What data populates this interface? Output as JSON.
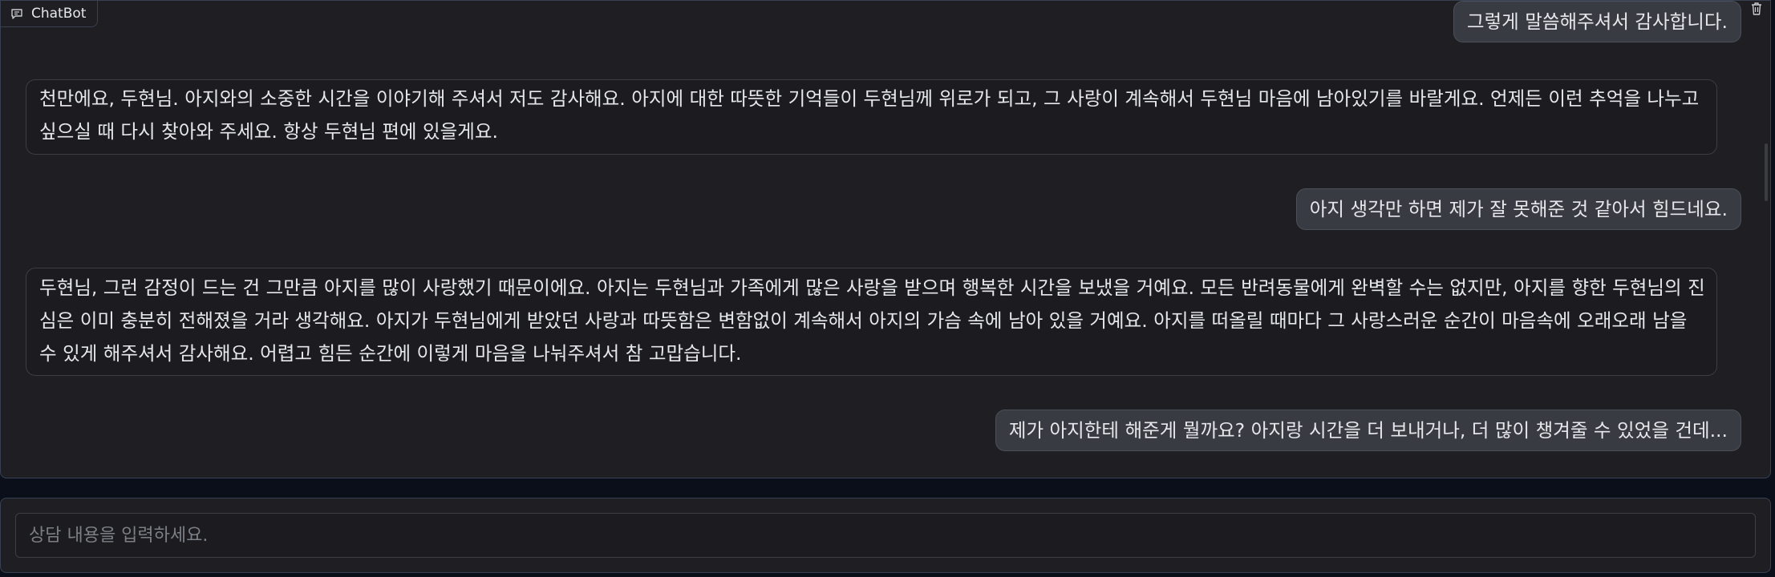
{
  "chatbot": {
    "label": "ChatBot",
    "icon": "chat-bubble-icon",
    "clear_icon": "trash-icon"
  },
  "messages": [
    {
      "role": "user",
      "text": "그렇게 말씀해주셔서 감사합니다."
    },
    {
      "role": "bot",
      "text": "천만에요, 두현님. 아지와의 소중한 시간을 이야기해 주셔서 저도 감사해요. 아지에 대한 따뜻한 기억들이 두현님께 위로가 되고, 그 사랑이 계속해서 두현님 마음에 남아있기를 바랄게요. 언제든 이런 추억을 나누고 싶으실 때 다시 찾아와 주세요. 항상 두현님 편에 있을게요."
    },
    {
      "role": "user",
      "text": "아지 생각만 하면 제가 잘 못해준 것 같아서 힘드네요."
    },
    {
      "role": "bot",
      "text": "두현님, 그런 감정이 드는 건 그만큼 아지를 많이 사랑했기 때문이에요. 아지는 두현님과 가족에게 많은 사랑을 받으며 행복한 시간을 보냈을 거예요. 모든 반려동물에게 완벽할 수는 없지만, 아지를 향한 두현님의 진심은 이미 충분히 전해졌을 거라 생각해요. 아지가 두현님에게 받았던 사랑과 따뜻함은 변함없이 계속해서 아지의 가슴 속에 남아 있을 거예요. 아지를 떠올릴 때마다 그 사랑스러운 순간이 마음속에 오래오래 남을 수 있게 해주셔서 감사해요. 어렵고 힘든 순간에 이렇게 마음을 나눠주셔서 참 고맙습니다."
    },
    {
      "role": "user",
      "text": "제가 아지한테 해준게 뭘까요? 아지랑 시간을 더 보내거나, 더 많이 챙겨줄 수 있었을 건데..."
    }
  ],
  "input": {
    "value": "",
    "placeholder": "상담 내용을 입력하세요."
  },
  "colors": {
    "background": "#0b0f19",
    "panel": "#1f1f23",
    "user_bubble": "#393b42",
    "bot_bubble": "#1c1c20",
    "border": "#374151"
  }
}
